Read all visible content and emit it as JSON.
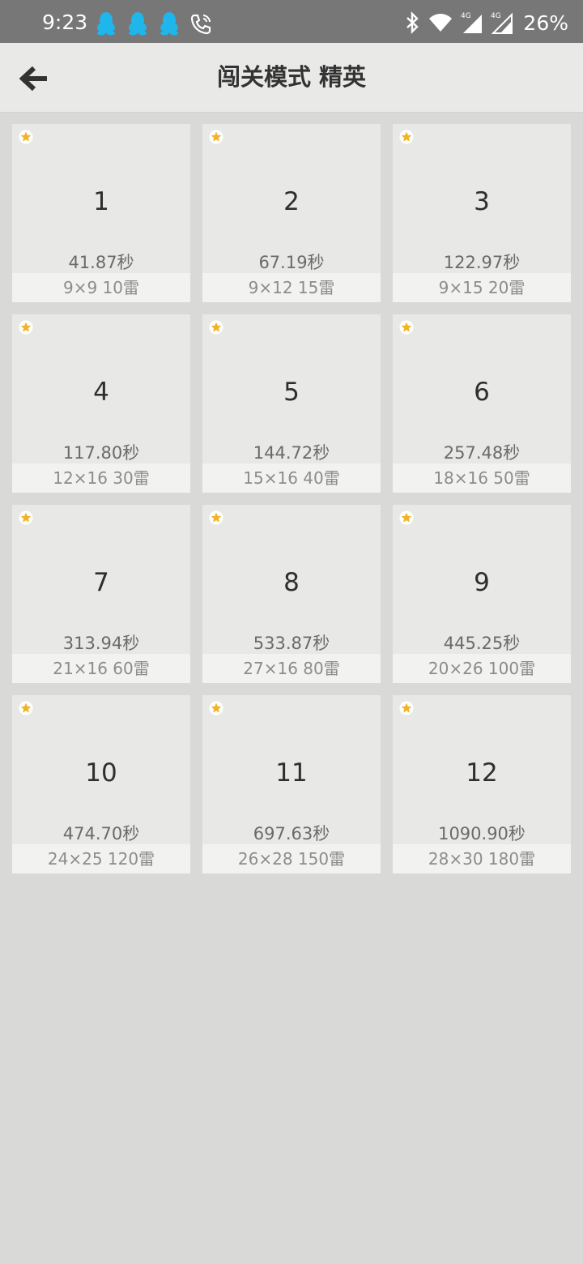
{
  "status_bar": {
    "time": "9:23",
    "notification_icons": [
      "qq-icon",
      "qq-icon",
      "qq-icon",
      "wifi-calling-icon"
    ],
    "battery": "26%",
    "network": "4G",
    "accent_qq": "#1fb6ec"
  },
  "app_bar": {
    "back_icon": "arrow-left-icon",
    "title": "闯关模式 精英"
  },
  "levels": [
    {
      "number": "1",
      "time": "41.87秒",
      "info": "9×9  10雷",
      "starred": true
    },
    {
      "number": "2",
      "time": "67.19秒",
      "info": "9×12  15雷",
      "starred": true
    },
    {
      "number": "3",
      "time": "122.97秒",
      "info": "9×15  20雷",
      "starred": true
    },
    {
      "number": "4",
      "time": "117.80秒",
      "info": "12×16  30雷",
      "starred": true
    },
    {
      "number": "5",
      "time": "144.72秒",
      "info": "15×16  40雷",
      "starred": true
    },
    {
      "number": "6",
      "time": "257.48秒",
      "info": "18×16  50雷",
      "starred": true
    },
    {
      "number": "7",
      "time": "313.94秒",
      "info": "21×16  60雷",
      "starred": true
    },
    {
      "number": "8",
      "time": "533.87秒",
      "info": "27×16  80雷",
      "starred": true
    },
    {
      "number": "9",
      "time": "445.25秒",
      "info": "20×26  100雷",
      "starred": true
    },
    {
      "number": "10",
      "time": "474.70秒",
      "info": "24×25  120雷",
      "starred": true
    },
    {
      "number": "11",
      "time": "697.63秒",
      "info": "26×28  150雷",
      "starred": true
    },
    {
      "number": "12",
      "time": "1090.90秒",
      "info": "28×30  180雷",
      "starred": true
    }
  ],
  "colors": {
    "star": "#f0b429",
    "background": "#d9d9d8",
    "card": "#e8e8e7"
  }
}
